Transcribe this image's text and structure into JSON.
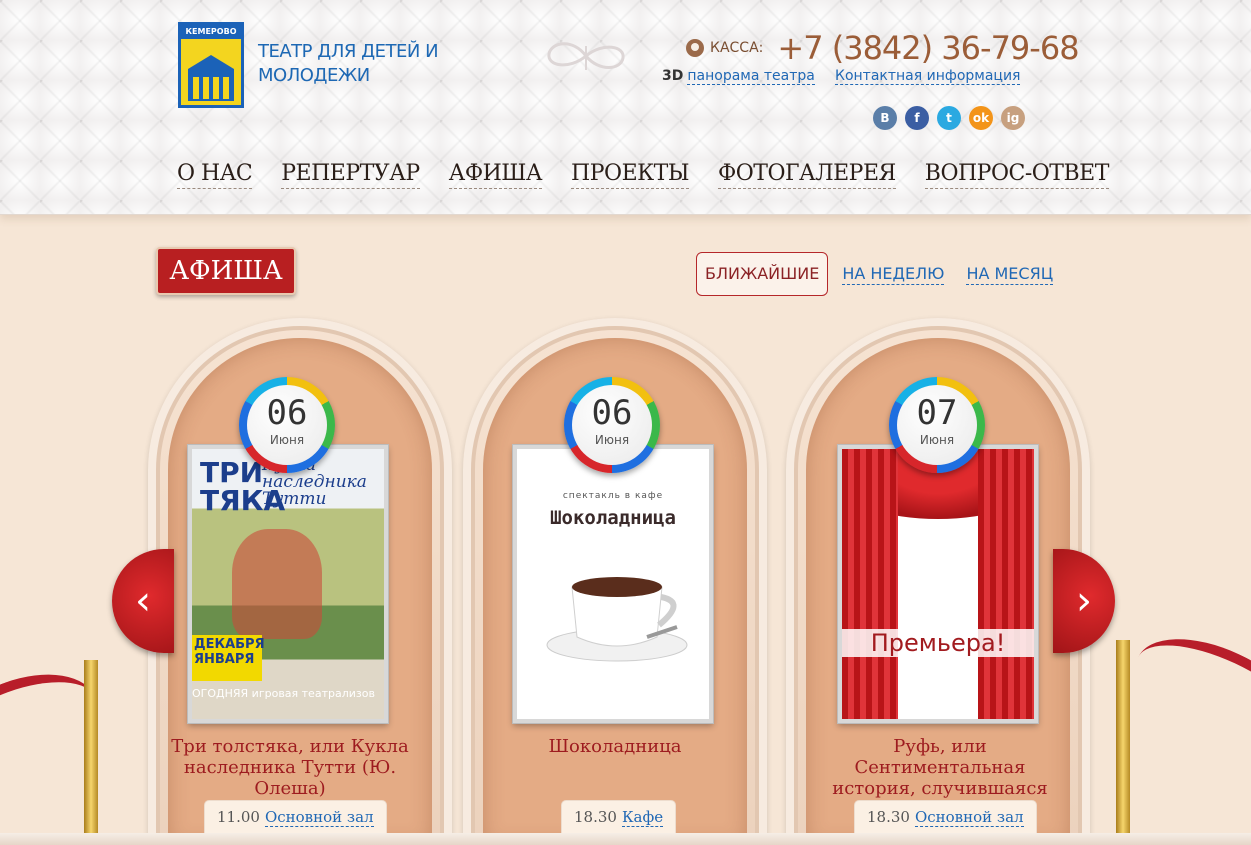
{
  "header": {
    "logo_city": "КЕМЕРОВО",
    "theatre_name": "ТЕАТР ДЛЯ ДЕТЕЙ И МОЛОДЕЖИ",
    "kassa_label": "КАССА:",
    "kassa_phone": "+7 (3842) 36-79-68",
    "link_3d_prefix": "3D",
    "link_3d": "панорама театра",
    "link_contacts": "Контактная информация",
    "social": [
      {
        "label": "B",
        "icon": "vk-icon",
        "color": "#5a7ea8"
      },
      {
        "label": "f",
        "icon": "facebook-icon",
        "color": "#3b5ea3"
      },
      {
        "label": "t",
        "icon": "twitter-icon",
        "color": "#2ba9e1"
      },
      {
        "label": "ok",
        "icon": "odnoklassniki-icon",
        "color": "#f39419"
      },
      {
        "label": "ig",
        "icon": "instagram-icon",
        "color": "#c7a07f"
      }
    ]
  },
  "nav": [
    "О НАС",
    "РЕПЕРТУАР",
    "АФИША",
    "ПРОЕКТЫ",
    "ФОТОГАЛЕРЕЯ",
    "ВОПРОС-ОТВЕТ"
  ],
  "section": {
    "title": "АФИША",
    "tabs": [
      "БЛИЖАЙШИЕ",
      "НА НЕДЕЛЮ",
      "НА МЕСЯЦ"
    ],
    "active_tab": "БЛИЖАЙШИЕ"
  },
  "shows": [
    {
      "day": "06",
      "month": "Июня",
      "title": "Три толстяка, или Кукла наследника Тутти (Ю. Олеша)",
      "time": "11.00",
      "hall": "Основной зал",
      "poster": {
        "line1": "ТРИ",
        "line2": "ТЯКА",
        "line3": "Кукла",
        "line4": "наследника",
        "line5": "Тутти",
        "dates1": "ДЕКАБРЯ",
        "dates2": "ЯНВАРЯ",
        "bottom": "ОГОДНЯЯ игровая театрализов"
      }
    },
    {
      "day": "06",
      "month": "Июня",
      "title": "Шоколадница",
      "time": "18.30",
      "hall": "Кафе",
      "poster": {
        "subtitle": "спектакль в кафе",
        "name": "Шоколадница"
      }
    },
    {
      "day": "07",
      "month": "Июня",
      "title": "Руфь, или Сентиментальная история, случившаяся",
      "time": "18.30",
      "hall": "Основной зал",
      "poster": {
        "label": "Премьера!"
      }
    }
  ],
  "arrows": {
    "prev": "‹",
    "next": "›"
  }
}
